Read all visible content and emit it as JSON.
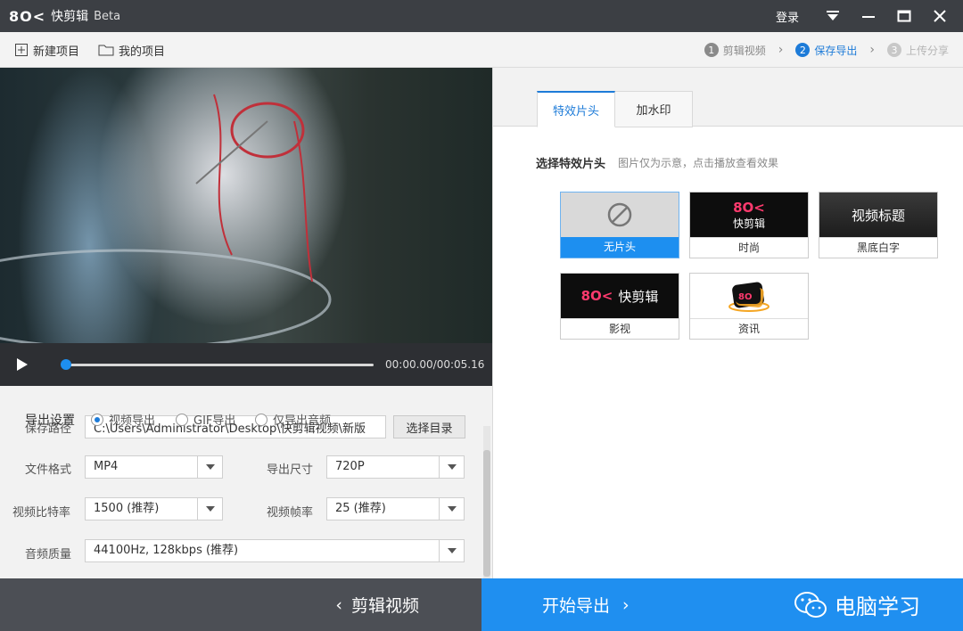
{
  "window": {
    "logo": "8O<",
    "app_name": "快剪辑",
    "edition": "Beta",
    "login": "登录"
  },
  "toolbar": {
    "new_project": "新建项目",
    "my_projects": "我的项目",
    "steps": [
      {
        "num": "1",
        "label": "剪辑视频"
      },
      {
        "num": "2",
        "label": "保存导出"
      },
      {
        "num": "3",
        "label": "上传分享"
      }
    ]
  },
  "player": {
    "timecode": "00:00.00/00:05.16",
    "progress": 0.0
  },
  "export": {
    "title": "导出设置",
    "modes": [
      "视频导出",
      "GIF导出",
      "仅导出音频"
    ],
    "selected_mode": "视频导出",
    "save_path_label": "保存路径",
    "save_path": "C:\\Users\\Administrator\\Desktop\\快剪辑视频\\新版",
    "choose_dir": "选择目录",
    "format_label": "文件格式",
    "format": "MP4",
    "size_label": "导出尺寸",
    "size": "720P",
    "bitrate_label": "视频比特率",
    "bitrate": "1500 (推荐)",
    "framerate_label": "视频帧率",
    "framerate": "25 (推荐)",
    "audio_label": "音频质量",
    "audio": "44100Hz, 128kbps (推荐)"
  },
  "bottom": {
    "back": "剪辑视频",
    "start": "开始导出",
    "watermark": "电脑学习"
  },
  "right": {
    "tabs": [
      "特效片头",
      "加水印"
    ],
    "select_title": "选择特效片头",
    "select_hint": "图片仅为示意，点击播放查看效果",
    "presets": [
      {
        "label": "无片头",
        "thumb": ""
      },
      {
        "label": "时尚",
        "thumb": "快剪辑"
      },
      {
        "label": "黑底白字",
        "thumb": "视频标题"
      },
      {
        "label": "影视",
        "thumb": "快剪辑"
      },
      {
        "label": "资讯",
        "thumb": ""
      }
    ],
    "accent": "#1d8ff0"
  }
}
